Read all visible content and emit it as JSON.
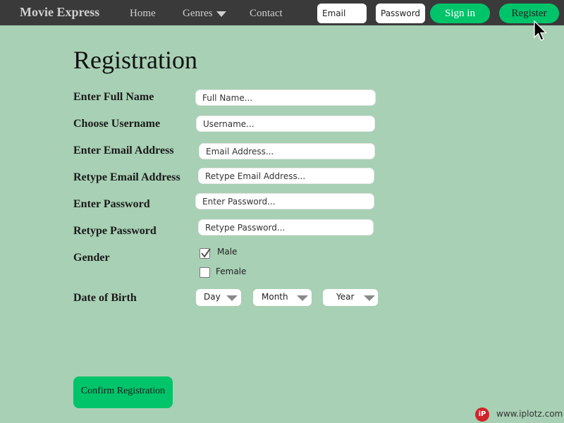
{
  "nav": {
    "brand": "Movie Express",
    "links": {
      "home": "Home",
      "genres": "Genres",
      "contact": "Contact"
    },
    "email_placeholder": "Email",
    "password_placeholder": "Password",
    "signin_label": "Sign in",
    "register_label": "Register"
  },
  "form": {
    "title": "Registration",
    "fields": {
      "full_name": {
        "label": "Enter Full Name",
        "placeholder": "Full Name..."
      },
      "username": {
        "label": "Choose Username",
        "placeholder": "Username..."
      },
      "email": {
        "label": "Enter Email Address",
        "placeholder": "Email Address..."
      },
      "email_confirm": {
        "label": "Retype Email Address",
        "placeholder": "Retype Email Address..."
      },
      "password": {
        "label": "Enter Password",
        "placeholder": "Enter Password..."
      },
      "password_confirm": {
        "label": "Retype Password",
        "placeholder": "Retype Password..."
      }
    },
    "gender": {
      "label": "Gender",
      "options": [
        {
          "label": "Male",
          "checked": true
        },
        {
          "label": "Female",
          "checked": false
        }
      ]
    },
    "dob": {
      "label": "Date of Birth",
      "day": "Day",
      "month": "Month",
      "year": "Year"
    },
    "confirm_label": "Confirm Registration"
  },
  "watermark": {
    "logo": "iP",
    "text": "www.iplotz.com"
  },
  "colors": {
    "background": "#a8d0b4",
    "navbar": "#3a3a3a",
    "accent": "#00c46a",
    "watermark_logo": "#d2232a"
  },
  "icons": {
    "genres_dropdown": "chevron-down-icon",
    "cursor": "mouse-pointer-icon",
    "checkbox": "checkmark-icon"
  }
}
